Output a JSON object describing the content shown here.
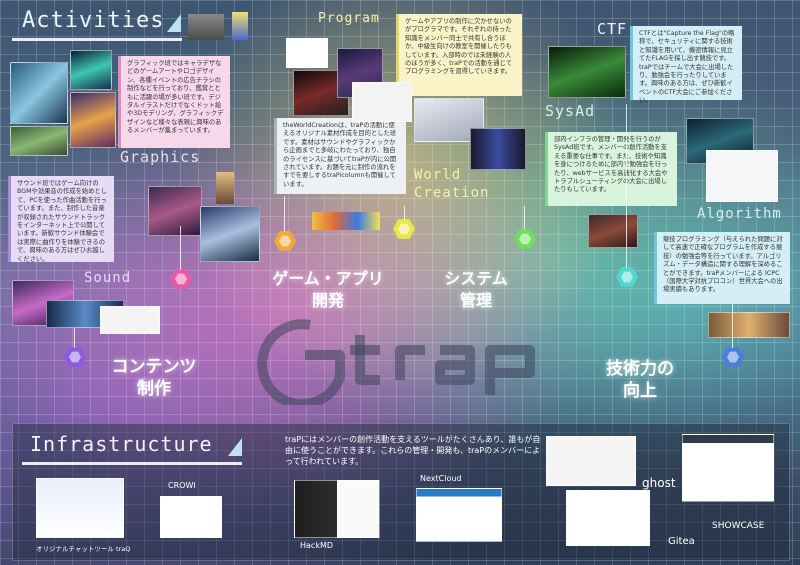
{
  "sections": {
    "activities": "Activities",
    "program": "Program",
    "ctf": "CTF",
    "sysad": "SysAd",
    "graphics": "Graphics",
    "world_creation": "World\nCreation",
    "algorithm": "Algorithm",
    "sound": "Sound",
    "infrastructure": "Infrastructure"
  },
  "panels": {
    "program": "ゲームやアプリの制作に欠かせないのがプログラマです。それぞれの持った知識をメンバー同士で共有し合うほか、中級生向けの教室を開催したりもしています。入部時のでは未経験の人のほうが多く、traPでの活動を通じてプログラミングを習得していきます。",
    "ctf": "CTFとは\"Capture the Flag\"の略称で、セキュリティに関する技術と知識を用いて、機密情報に見立てたFLAGを探し出す競技です。traPではチームで大会に出場したり、勉強会を行ったりしています。興味のある方は、ぜひ新歓イベントのCTF大会にご参加ください。",
    "graphics": "グラフィック班ではキャラデザなどのゲームアートやロゴデザイン、各種イベントの広告チラシの制作などを行っており、鑑賞とともに活躍の場が多い班です。デジタルイラストだけでなくドット絵や3Dモデリング、グラフィックデザインなど様々な表現に興味のあるメンバーが集まっています。",
    "worldcreation": "theWorldCreationは、traPの活動に使えるオリジナル素材作成を目的とした班です。素材はサウンドやグラフィックから企画までと多岐にわたっており、独自のライセンスに基づいてtraPが内に公開されています。お題を元に制作の流れをすでを要しするtraPicolumnも開催しています。",
    "sysad": "部内インフラの管理・開発を行うのがSysAd班です。メンバーの創作活動を支える重要な仕事です。また、技術や知識を身につけるために部内で勉強会を行ったり、webサービスを高速化する大会やトラブルシューティングの大会に出場したりもしています。",
    "sound": "サウンド班ではゲーム向けのBGMや効果音の作成を始めとして、PCを使った作曲活動を行っています。また、制作した音楽が収録されたサウンドトラックをインターネット上で公開しています。新歓サウンド体験会では実際に曲作りを体験できるので、興味のある方はぜひお越しください。",
    "algorithm": "競技プログラミング（与えられた問題に対して高速で正確なプログラムを作成する競技）の勉強会等を行っています。アルゴリズム・データ構造に関する理解を深めることができます。traPメンバーによる ICPC（国際大学対抗プロコン）世界大会への出場実績もあります。"
  },
  "big_labels": {
    "game_app": "ゲーム・アプリ\n開発",
    "system": "システム\n管理",
    "content": "コンテンツ\n制作",
    "tech": "技術力の\n向上"
  },
  "infrastructure": {
    "description": "traPにはメンバーの創作活動を支えるツールがたくさんあり、誰もが自由に使うことができます。これらの管理・開発も、traPのメンバーによって行われています。",
    "tools": {
      "traq": "オリジナルチャットツール traQ",
      "crowi": "CROWI",
      "hackmd": "HackMD",
      "nextcloud": "NextCloud",
      "ghost": "ghost",
      "gitea": "Gitea",
      "showcase": "SHOWCASE"
    }
  },
  "colors": {
    "pink": "#e85aa8",
    "orange": "#f2a93a",
    "yellow": "#e8e84a",
    "green": "#6fde5a",
    "cyan": "#4fd8d0",
    "blue": "#4a7de0",
    "purple": "#8a5ae0"
  }
}
